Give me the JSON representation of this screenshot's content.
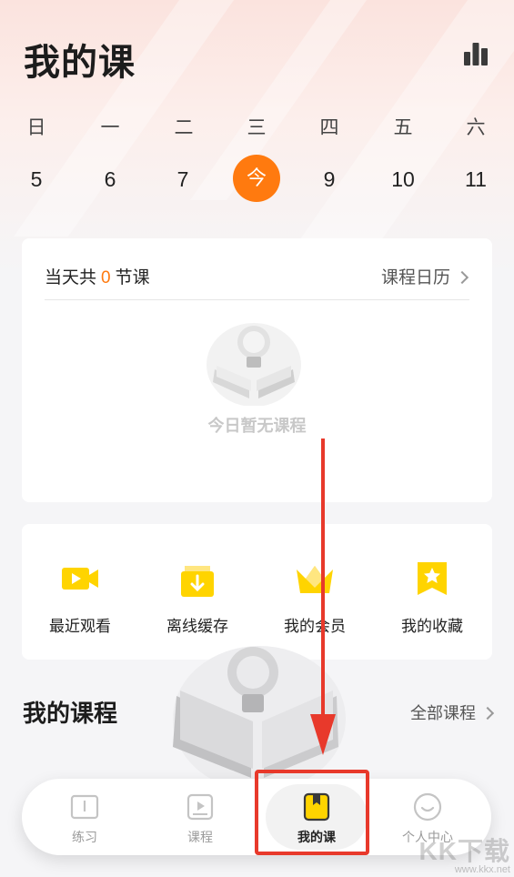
{
  "page": {
    "title": "我的课"
  },
  "colors": {
    "accent": "#ff7a0f",
    "highlight": "#e8392b",
    "icon_yellow": "#ffd400"
  },
  "week": {
    "days": [
      "日",
      "一",
      "二",
      "三",
      "四",
      "五",
      "六"
    ],
    "dates": [
      "5",
      "6",
      "7",
      "今",
      "9",
      "10",
      "11"
    ],
    "today_index": 3
  },
  "today_card": {
    "prefix": "当天共",
    "count": "0",
    "suffix": "节课",
    "calendar_link": "课程日历",
    "empty_text": "今日暂无课程"
  },
  "quick_actions": [
    {
      "label": "最近观看",
      "icon": "video-icon"
    },
    {
      "label": "离线缓存",
      "icon": "download-icon"
    },
    {
      "label": "我的会员",
      "icon": "crown-icon"
    },
    {
      "label": "我的收藏",
      "icon": "star-bookmark-icon"
    }
  ],
  "my_courses": {
    "title": "我的课程",
    "all_link": "全部课程"
  },
  "tabbar": {
    "items": [
      {
        "label": "练习",
        "icon": "book-icon"
      },
      {
        "label": "课程",
        "icon": "play-icon"
      },
      {
        "label": "我的课",
        "icon": "bookmark-icon"
      },
      {
        "label": "个人中心",
        "icon": "profile-icon"
      }
    ],
    "active_index": 2
  },
  "watermark": {
    "main": "KK下载",
    "sub": "www.kkx.net"
  }
}
